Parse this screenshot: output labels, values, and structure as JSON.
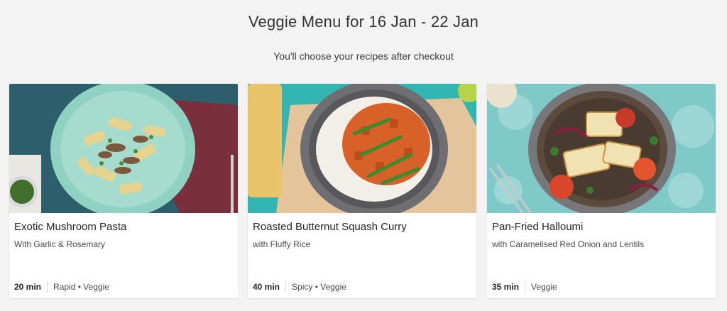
{
  "header": {
    "title": "Veggie Menu for 16 Jan - 22 Jan",
    "subtitle": "You'll choose your recipes after checkout"
  },
  "recipes": [
    {
      "name": "Exotic Mushroom Pasta",
      "subtitle": "With Garlic & Rosemary",
      "time": "20 min",
      "tags": "Rapid • Veggie"
    },
    {
      "name": "Roasted Butternut Squash Curry",
      "subtitle": "with Fluffy Rice",
      "time": "40 min",
      "tags": "Spicy • Veggie"
    },
    {
      "name": "Pan-Fried Halloumi",
      "subtitle": "with Caramelised Red Onion and Lentils",
      "time": "35 min",
      "tags": "Veggie"
    }
  ],
  "colors": {
    "background": "#f3f3f3",
    "card": "#ffffff",
    "text": "#242424"
  }
}
